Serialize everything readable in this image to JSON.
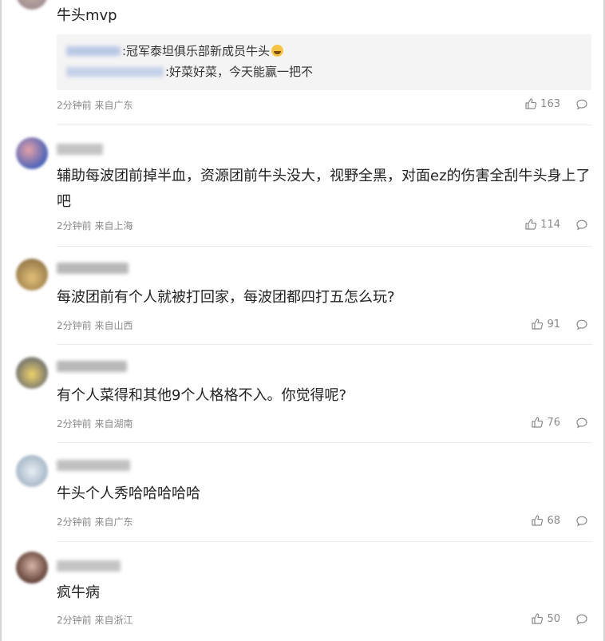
{
  "comments": [
    {
      "text": "牛头mvp",
      "quotes": [
        {
          "text": ":冠军泰坦俱乐部新成员牛头",
          "emoji": "laugh-cry-emoji"
        },
        {
          "text": ":好菜好菜，今天能赢一把不"
        }
      ],
      "meta": "2分钟前 来自广东",
      "likes": "163"
    },
    {
      "text": "辅助每波团前掉半血，资源团前牛头没大，视野全黑，对面ez的伤害全刮牛头身上了吧",
      "meta": "2分钟前 来自上海",
      "likes": "114"
    },
    {
      "text": "每波团前有个人就被打回家，每波团都四打五怎么玩?",
      "meta": "2分钟前 来自山西",
      "likes": "91"
    },
    {
      "text": "有个人菜得和其他9个人格格不入。你觉得呢?",
      "meta": "2分钟前 来自湖南",
      "likes": "76"
    },
    {
      "text": "牛头个人秀哈哈哈哈哈",
      "meta": "2分钟前 来自广东",
      "likes": "68"
    },
    {
      "text": "疯牛病",
      "meta": "2分钟前 来自浙江",
      "likes": "50"
    }
  ],
  "icons": {
    "like": "thumbs-up-icon",
    "reply": "comment-bubble-icon"
  },
  "colors": {
    "meta_text": "#8a8a8a",
    "quote_bg": "#f4f4f4"
  }
}
